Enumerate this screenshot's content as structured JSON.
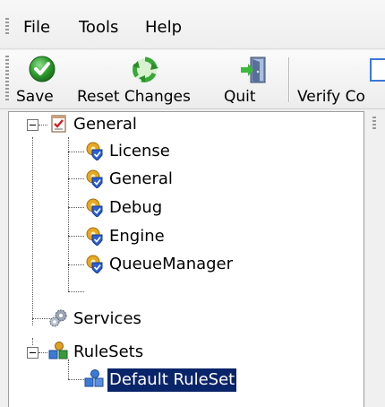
{
  "menubar": {
    "items": [
      {
        "label": "File"
      },
      {
        "label": "Tools"
      },
      {
        "label": "Help"
      }
    ]
  },
  "toolbar": {
    "buttons": [
      {
        "label": "Save",
        "icon": "check-circle-icon"
      },
      {
        "label": "Reset Changes",
        "icon": "recycle-arrows-icon"
      },
      {
        "label": "Quit",
        "icon": "exit-door-icon"
      },
      {
        "label": "Verify Co",
        "icon": "document-icon"
      }
    ]
  },
  "tree": {
    "nodes": [
      {
        "label": "General",
        "icon": "checklist-icon",
        "expanded": true,
        "level": 0
      },
      {
        "label": "License",
        "icon": "shield-gear-icon",
        "level": 1
      },
      {
        "label": "General",
        "icon": "shield-gear-icon",
        "level": 1
      },
      {
        "label": "Debug",
        "icon": "shield-gear-icon",
        "level": 1
      },
      {
        "label": "Engine",
        "icon": "shield-gear-icon",
        "level": 1
      },
      {
        "label": "QueueManager",
        "icon": "shield-gear-icon",
        "level": 1
      },
      {
        "label": "Services",
        "icon": "gears-icon",
        "level": 0
      },
      {
        "label": "RuleSets",
        "icon": "shapes-icon",
        "expanded": true,
        "level": 0
      },
      {
        "label": "Default RuleSet",
        "icon": "shapes-icon",
        "selected": true,
        "level": 1
      }
    ]
  },
  "colors": {
    "selection": "#0a246a",
    "check_green": "#2e9e2e",
    "shield_gold": "#e8a820",
    "shield_blue": "#2c5fd0"
  }
}
